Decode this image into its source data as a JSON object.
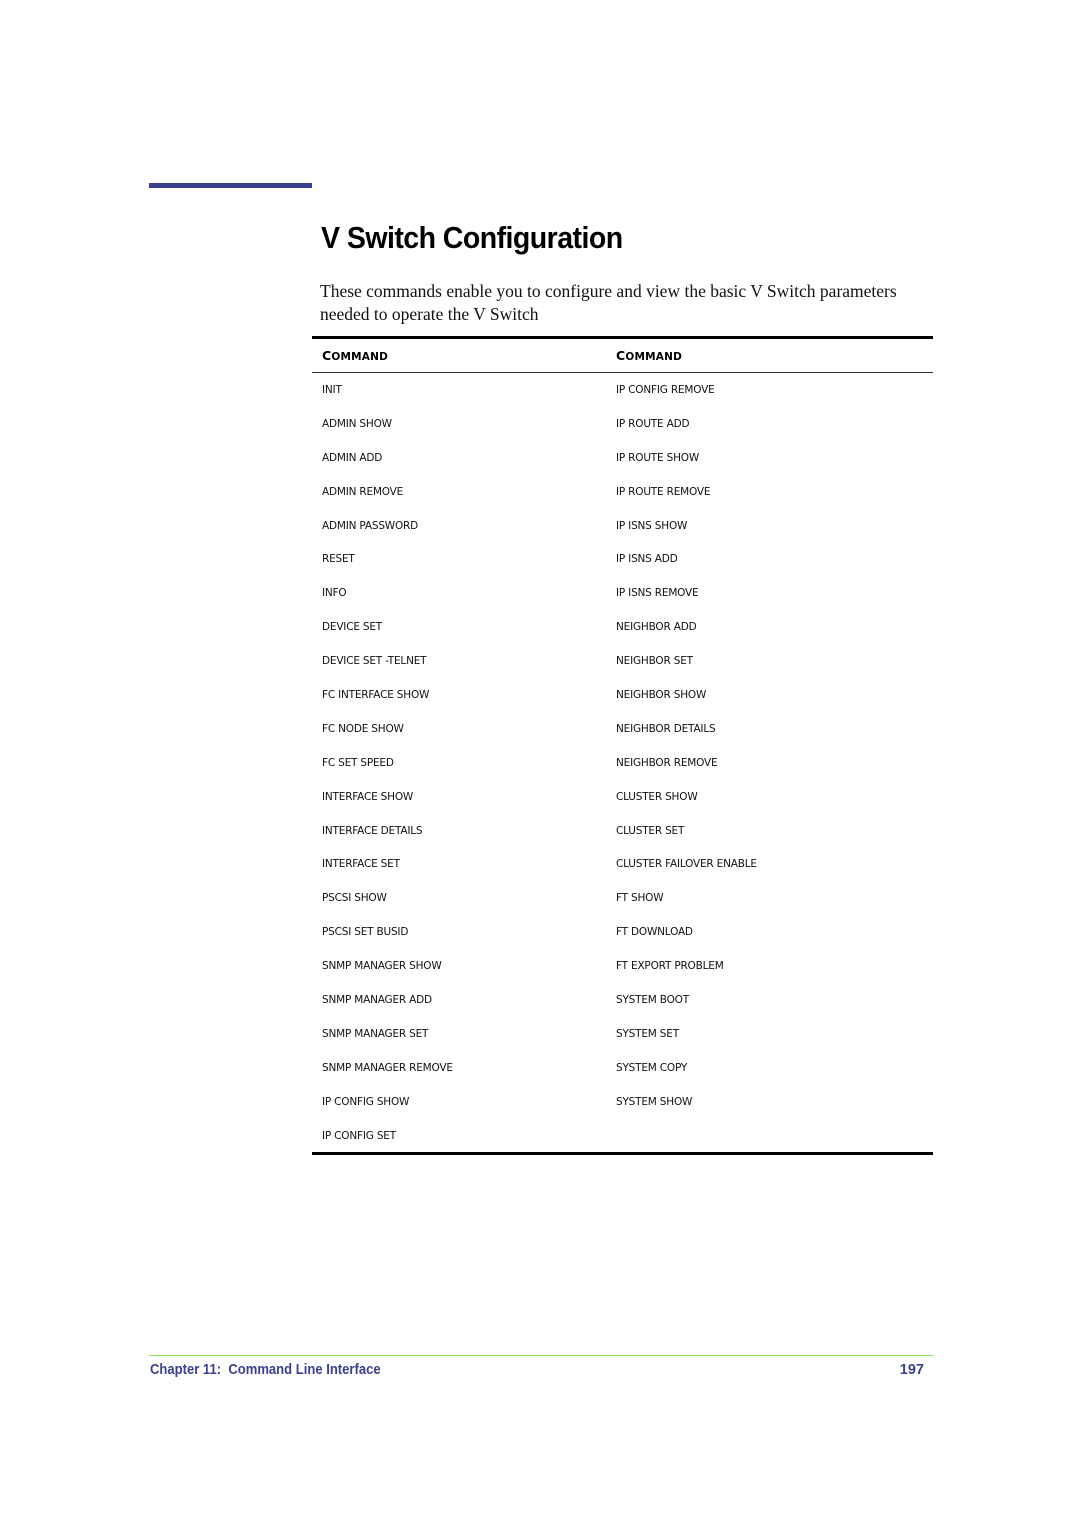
{
  "page": {
    "title": "V Switch Configuration",
    "intro": "These commands enable you to configure and view the basic V Switch parameters needed to operate the V Switch"
  },
  "table": {
    "headers": [
      "Command",
      "Command"
    ],
    "rows": [
      [
        "INIT",
        "IP CONFIG REMOVE"
      ],
      [
        "ADMIN SHOW",
        "IP ROUTE ADD"
      ],
      [
        "ADMIN ADD",
        "IP ROUTE SHOW"
      ],
      [
        "ADMIN REMOVE",
        "IP ROUTE REMOVE"
      ],
      [
        "ADMIN PASSWORD",
        "IP ISNS SHOW"
      ],
      [
        "RESET",
        "IP ISNS ADD"
      ],
      [
        "INFO",
        "IP ISNS REMOVE"
      ],
      [
        "DEVICE SET",
        "NEIGHBOR ADD"
      ],
      [
        "DEVICE SET -TELNET",
        "NEIGHBOR SET"
      ],
      [
        "FC INTERFACE SHOW",
        "NEIGHBOR SHOW"
      ],
      [
        "FC NODE SHOW",
        "NEIGHBOR DETAILS"
      ],
      [
        "FC SET SPEED",
        "NEIGHBOR REMOVE"
      ],
      [
        "INTERFACE SHOW",
        "CLUSTER SHOW"
      ],
      [
        "INTERFACE DETAILS",
        "CLUSTER SET"
      ],
      [
        "INTERFACE SET",
        "CLUSTER FAILOVER ENABLE"
      ],
      [
        "PSCSI SHOW",
        "FT SHOW"
      ],
      [
        "PSCSI SET BUSID",
        "FT DOWNLOAD"
      ],
      [
        "SNMP MANAGER SHOW",
        "FT EXPORT PROBLEM"
      ],
      [
        "SNMP MANAGER ADD",
        "SYSTEM BOOT"
      ],
      [
        "SNMP MANAGER SET",
        "SYSTEM SET"
      ],
      [
        "SNMP MANAGER REMOVE",
        "SYSTEM COPY"
      ],
      [
        "IP CONFIG SHOW",
        "SYSTEM SHOW"
      ],
      [
        "IP CONFIG SET",
        ""
      ]
    ]
  },
  "footer": {
    "chapter": "Chapter 11:  Command Line Interface",
    "page_number": "197"
  },
  "colors": {
    "accent": "#3a3f8f",
    "footer_rule": "#8bdc5a"
  }
}
